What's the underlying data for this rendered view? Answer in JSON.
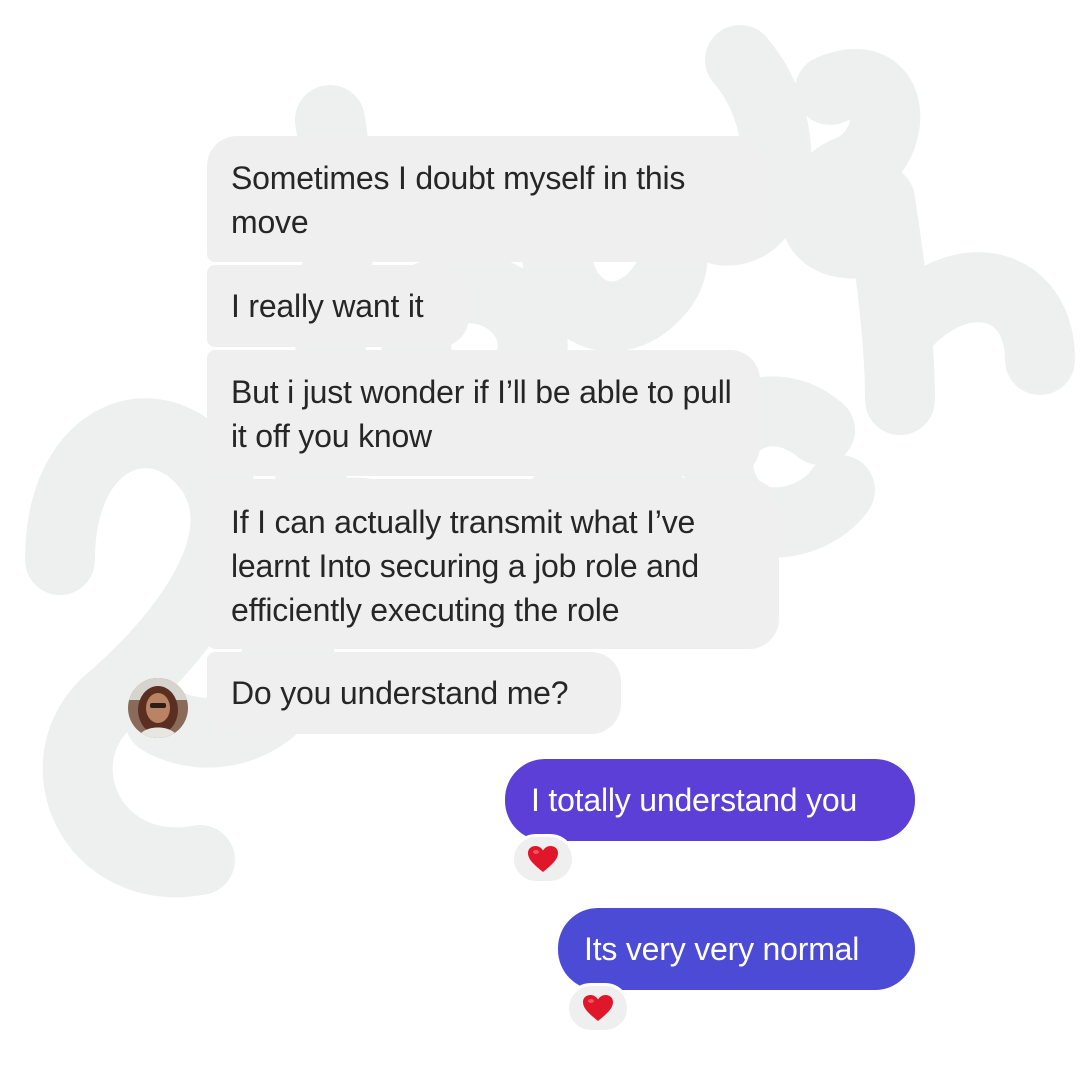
{
  "conversation": {
    "incoming": [
      {
        "text": "Sometimes I doubt myself in this move"
      },
      {
        "text": "I really want it"
      },
      {
        "text": "But i just wonder  if I’ll be able to pull it off you know"
      },
      {
        "text": "If I can actually transmit what I’ve learnt Into securing a job role and efficiently executing the role"
      },
      {
        "text": "Do you understand me?"
      }
    ],
    "outgoing": [
      {
        "text": "I totally understand you",
        "reaction": "heart-icon"
      },
      {
        "text": "Its  very very normal",
        "reaction": "heart-icon"
      }
    ]
  },
  "colors": {
    "incoming_bubble": "#efefef",
    "outgoing_bubble_top": "#5b3fd6",
    "outgoing_bubble_bottom": "#4c4bd6",
    "heart": "#e0162b"
  }
}
